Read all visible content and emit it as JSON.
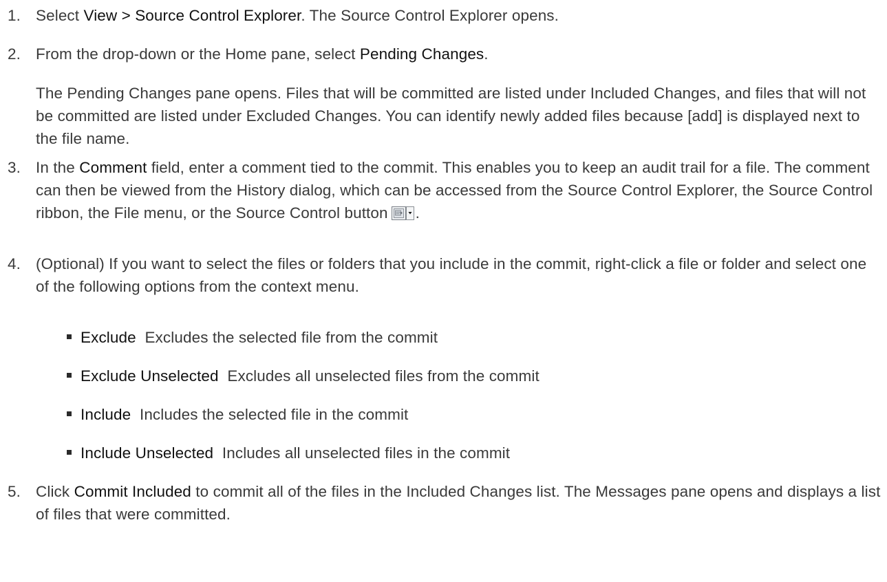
{
  "steps": [
    {
      "number": "1.",
      "pre": "Select ",
      "em": "View > Source Control Explorer",
      "post": ". The Source Control Explorer opens."
    },
    {
      "number": "2.",
      "pre": "From the drop-down or the Home pane, select ",
      "em": "Pending Changes",
      "post": ".",
      "paragraph": "The Pending Changes pane opens. Files that will be committed are listed under Included Changes, and files that will not be committed are listed under Excluded Changes. You can identify newly added files because [add] is displayed next to the file name."
    },
    {
      "number": "3.",
      "pre": "In the ",
      "em": "Comment",
      "post": " field, enter a comment tied to the commit. This enables you to keep an audit trail for a file. The comment can then be viewed from the History dialog, which can be accessed from the Source Control Explorer, the Source Control ribbon, the File menu, or the Source Control button",
      "tail": "."
    },
    {
      "number": "4.",
      "text": "(Optional) If you want to select the files or folders that you include in the commit, right-click a file or folder and select one of the following options from the context menu.",
      "bullets": [
        {
          "term": "Exclude",
          "desc": "Excludes the selected file from the commit"
        },
        {
          "term": "Exclude Unselected",
          "desc": "Excludes all unselected files from the commit"
        },
        {
          "term": "Include",
          "desc": "Includes the selected file in the commit"
        },
        {
          "term": "Include Unselected",
          "desc": "Includes all unselected files in the commit"
        }
      ]
    },
    {
      "number": "5.",
      "pre": "Click ",
      "em": "Commit Included",
      "post": " to commit all of the files in the Included Changes list. The Messages pane opens and displays a list of files that were committed."
    }
  ],
  "icons": {
    "source_control_button": "source-control-dropdown-icon"
  }
}
